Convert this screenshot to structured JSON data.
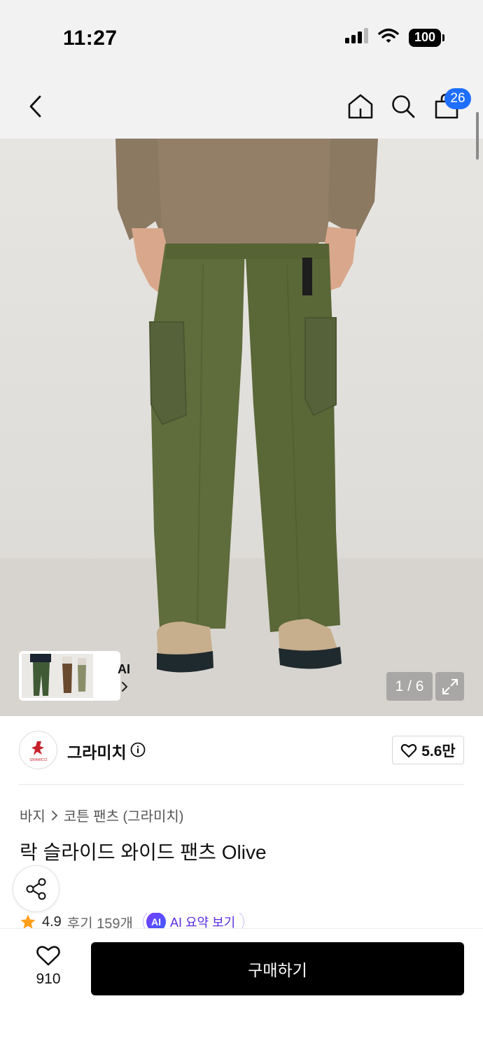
{
  "status_bar": {
    "time": "11:27",
    "battery": "100",
    "icons": [
      "cellular-signal-icon",
      "wifi-icon",
      "battery-icon"
    ]
  },
  "nav": {
    "icons": [
      "back-chevron-icon",
      "home-icon",
      "search-icon",
      "shopping-bag-icon"
    ],
    "cart_count": "26"
  },
  "gallery": {
    "thumbnail_label": "AI",
    "current_page": 1,
    "total_pages": 6,
    "counter": "1 / 6",
    "expand_icon": "expand-icon"
  },
  "brand": {
    "name": "그라미치",
    "logo_text": "GRAMICCI",
    "likes": "5.6만"
  },
  "product": {
    "breadcrumb": [
      "바지",
      "코튼 팬츠 (그라미치)"
    ],
    "title": "락 슬라이드 와이드 팬츠 Olive",
    "rating": "4.9",
    "reviews": "후기 159개",
    "ai_badge": "AI",
    "ai_summary": "AI 요약 보기"
  },
  "bottom_bar": {
    "wish_count": "910",
    "buy_label": "구매하기"
  },
  "colors": {
    "accent_blue": "#1f6fff",
    "ai_purple": "#5a2ee0",
    "star": "#ff9f1a",
    "pants_olive": "#5d6a3a",
    "buy_button": "#000000"
  }
}
